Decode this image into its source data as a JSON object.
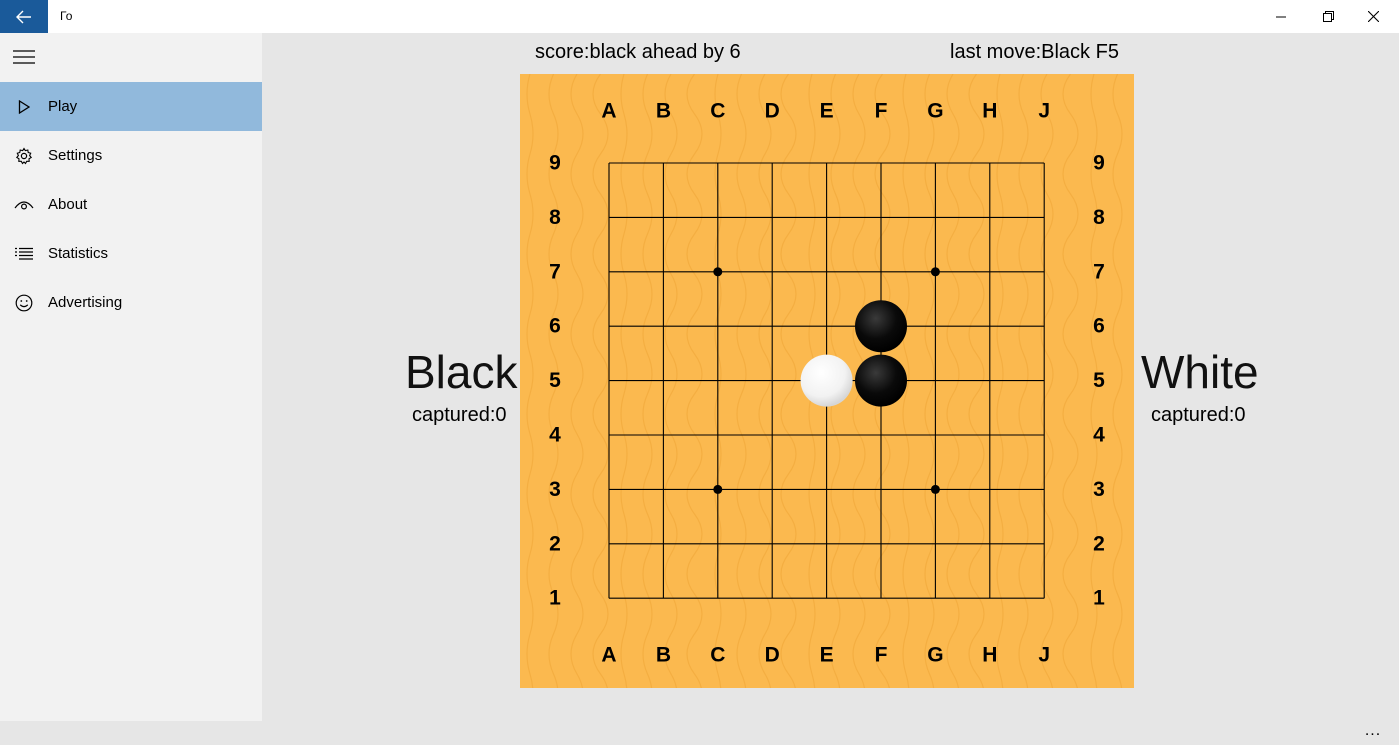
{
  "window": {
    "title": "Го",
    "back_icon": "arrow-left-icon"
  },
  "sidebar": {
    "items": [
      {
        "label": "Play",
        "icon": "play-icon",
        "selected": true
      },
      {
        "label": "Settings",
        "icon": "gear-icon",
        "selected": false
      },
      {
        "label": "About",
        "icon": "eye-icon",
        "selected": false
      },
      {
        "label": "Statistics",
        "icon": "list-icon",
        "selected": false
      },
      {
        "label": "Advertising",
        "icon": "smiley-icon",
        "selected": false
      }
    ]
  },
  "game": {
    "score": "score:black ahead by 6",
    "last_move": "last move:Black F5",
    "black": {
      "name": "Black",
      "captured": "captured:0"
    },
    "white": {
      "name": "White",
      "captured": "captured:0"
    },
    "board": {
      "size": 9,
      "columns": [
        "A",
        "B",
        "C",
        "D",
        "E",
        "F",
        "G",
        "H",
        "J"
      ],
      "rows": [
        "9",
        "8",
        "7",
        "6",
        "5",
        "4",
        "3",
        "2",
        "1"
      ],
      "star_points": [
        "C7",
        "G7",
        "C3",
        "G3"
      ],
      "stones": [
        {
          "point": "F6",
          "color": "black"
        },
        {
          "point": "F5",
          "color": "black"
        },
        {
          "point": "E5",
          "color": "white"
        }
      ]
    }
  },
  "more_label": "...",
  "colors": {
    "board": "#fbb94f",
    "selected_nav": "#91b9dc",
    "back_button": "#1a5a9a"
  }
}
